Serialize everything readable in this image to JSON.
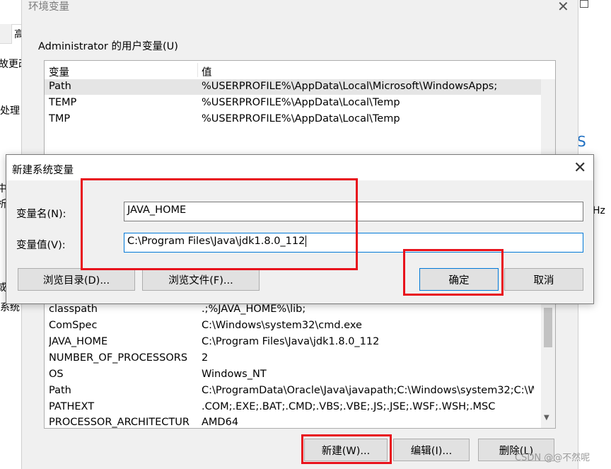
{
  "background": {
    "tab_label": "高",
    "left_fragments": [
      "故更改",
      "处理",
      "中",
      "析",
      "或",
      "系统"
    ],
    "right_fragment_s": "S",
    "right_fragment_hz": "Hz"
  },
  "env_window": {
    "title": "环境变量",
    "user_section_label": "Administrator 的用户变量(U)",
    "columns": [
      "变量",
      "值"
    ],
    "user_vars": [
      {
        "name": "Path",
        "value": "%USERPROFILE%\\AppData\\Local\\Microsoft\\WindowsApps;"
      },
      {
        "name": "TEMP",
        "value": "%USERPROFILE%\\AppData\\Local\\Temp"
      },
      {
        "name": "TMP",
        "value": "%USERPROFILE%\\AppData\\Local\\Temp"
      }
    ],
    "system_vars": [
      {
        "name": "classpath",
        "value": ".;%JAVA_HOME%\\lib;"
      },
      {
        "name": "ComSpec",
        "value": "C:\\Windows\\system32\\cmd.exe"
      },
      {
        "name": "JAVA_HOME",
        "value": "C:\\Program Files\\Java\\jdk1.8.0_112"
      },
      {
        "name": "NUMBER_OF_PROCESSORS",
        "value": "2"
      },
      {
        "name": "OS",
        "value": "Windows_NT"
      },
      {
        "name": "Path",
        "value": "C:\\ProgramData\\Oracle\\Java\\javapath;C:\\Windows\\system32;C:\\Wi..."
      },
      {
        "name": "PATHEXT",
        "value": ".COM;.EXE;.BAT;.CMD;.VBS;.VBE;.JS;.JSE;.WSF;.WSH;.MSC"
      },
      {
        "name": "PROCESSOR_ARCHITECTURE",
        "value": "AMD64"
      }
    ],
    "buttons": {
      "new": "新建(W)...",
      "edit": "编辑(I)...",
      "delete": "删除(L)"
    }
  },
  "dialog": {
    "title": "新建系统变量",
    "name_label": "变量名(N):",
    "value_label": "变量值(V):",
    "name_value": "JAVA_HOME",
    "value_value": "C:\\Program Files\\Java\\jdk1.8.0_112",
    "browse_dir": "浏览目录(D)...",
    "browse_file": "浏览文件(F)...",
    "ok": "确定",
    "cancel": "取消"
  },
  "watermark": "CSDN @@不然呢",
  "colors": {
    "highlight_red": "#e8121c",
    "focus_blue": "#0078d7",
    "window_bg": "#f0f0f0"
  }
}
